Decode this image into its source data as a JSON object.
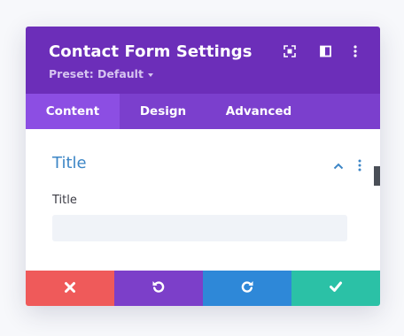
{
  "header": {
    "title": "Contact Form Settings",
    "preset_label": "Preset: Default",
    "icons": [
      "fullscreen-icon",
      "split-view-icon",
      "more-options-icon"
    ]
  },
  "tabs": [
    {
      "label": "Content",
      "active": true
    },
    {
      "label": "Design",
      "active": false
    },
    {
      "label": "Advanced",
      "active": false
    }
  ],
  "section": {
    "title": "Title",
    "icons": [
      "chevron-up-icon",
      "more-options-icon"
    ],
    "field_label": "Title",
    "field_value": "",
    "field_placeholder": ""
  },
  "footer": {
    "buttons": [
      {
        "name": "discard",
        "icon": "close-icon",
        "color": "#ef5a5a"
      },
      {
        "name": "undo",
        "icon": "undo-icon",
        "color": "#7c3fc9"
      },
      {
        "name": "redo",
        "icon": "redo-icon",
        "color": "#2e88d8"
      },
      {
        "name": "save",
        "icon": "check-icon",
        "color": "#2bc1a6"
      }
    ]
  },
  "colors": {
    "header_bg": "#6c2eb9",
    "tabs_bg": "#7b3fcd",
    "active_tab_bg": "#8c4ee3",
    "accent_blue": "#3d86c6"
  }
}
